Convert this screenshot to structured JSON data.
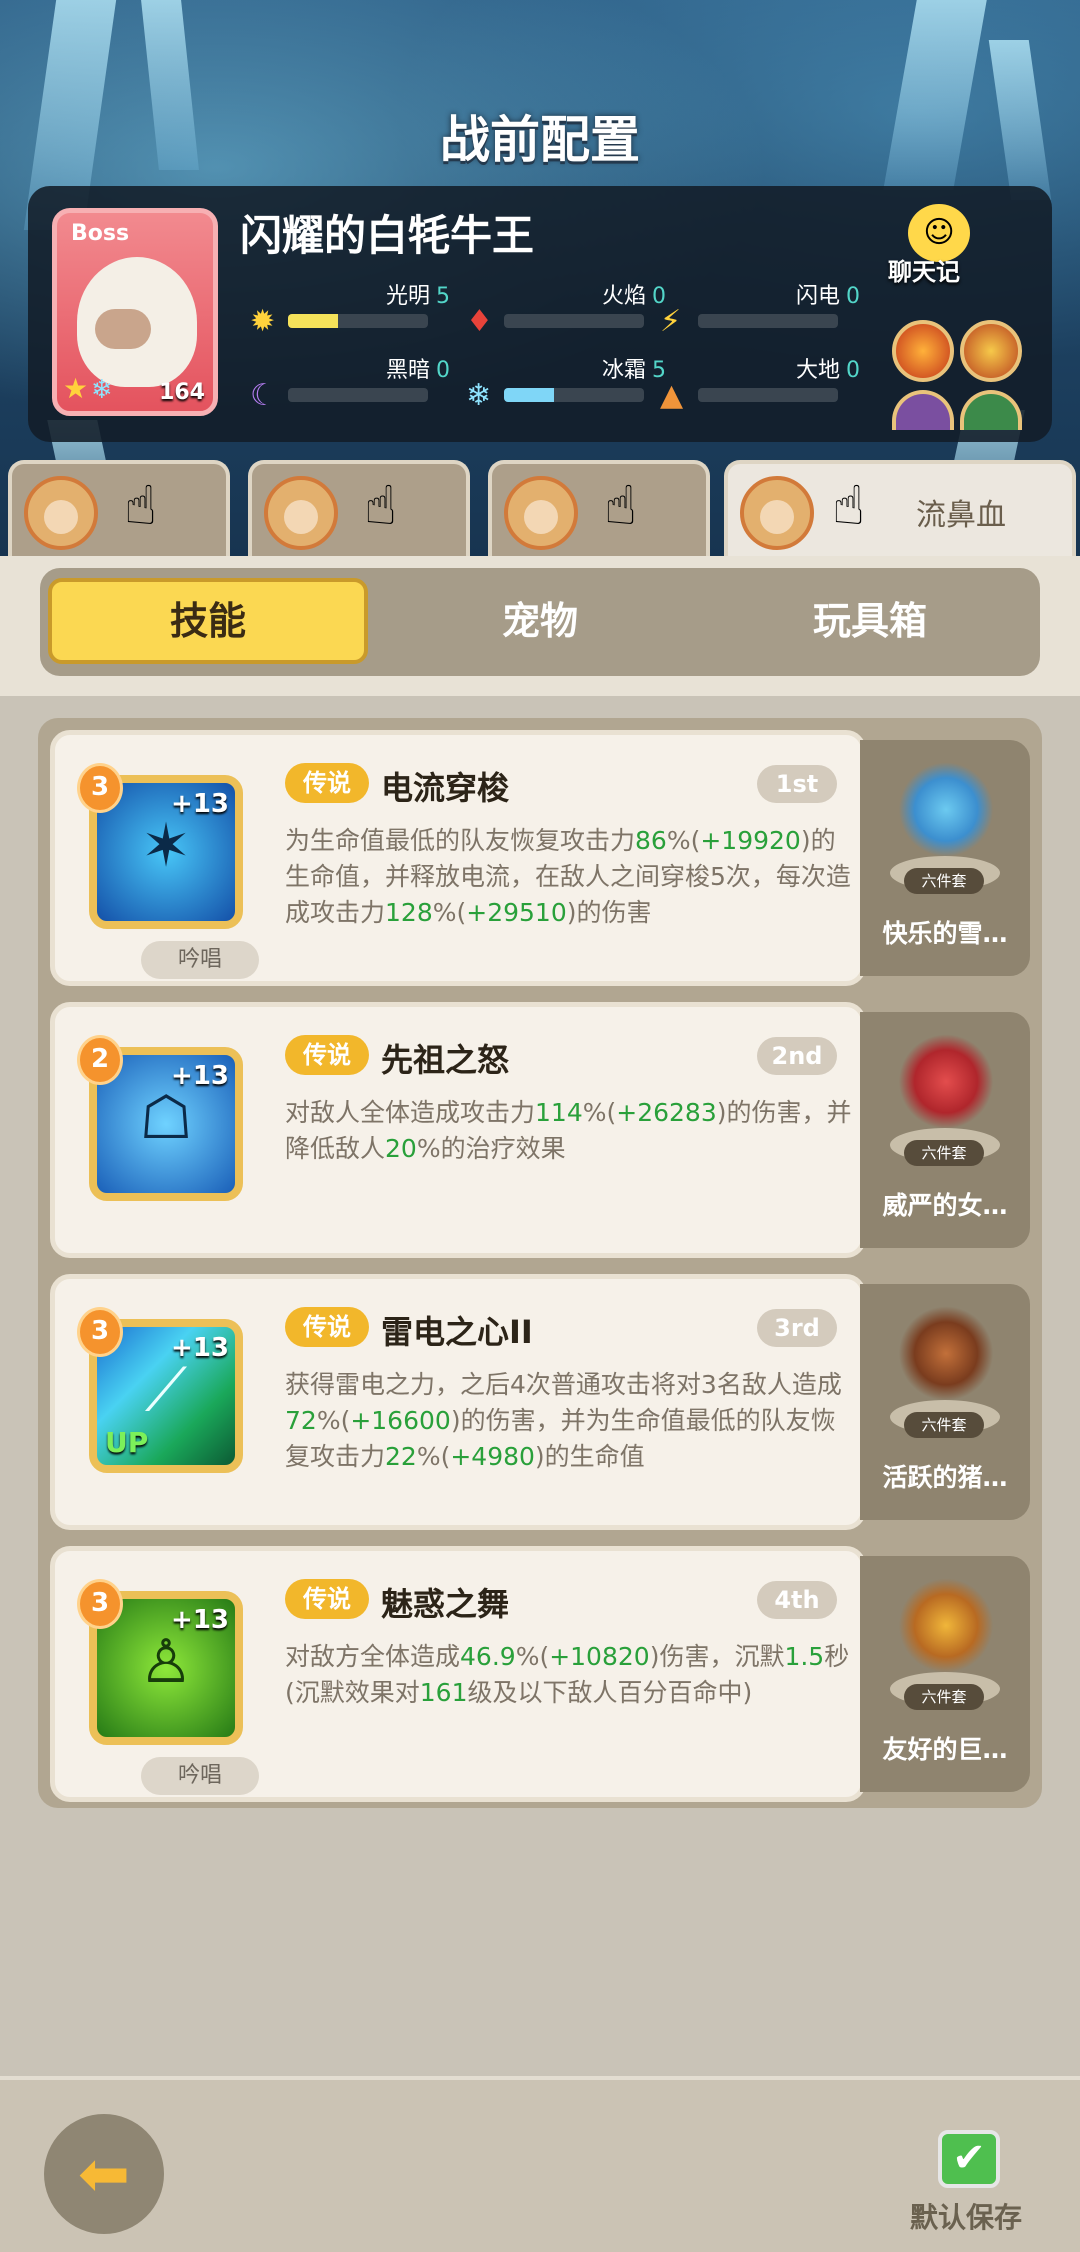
{
  "title": "战前配置",
  "boss": {
    "tag": "Boss",
    "name": "闪耀的白牦牛王",
    "level": "164",
    "chat_label": "聊天记",
    "elements": [
      {
        "name": "光明",
        "value": "5",
        "icon": "sun-icon",
        "fill": 5
      },
      {
        "name": "火焰",
        "value": "0",
        "icon": "flame-icon",
        "fill": 0
      },
      {
        "name": "闪电",
        "value": "0",
        "icon": "lightning-icon",
        "fill": 0
      },
      {
        "name": "黑暗",
        "value": "0",
        "icon": "moon-icon",
        "fill": 0
      },
      {
        "name": "冰霜",
        "value": "5",
        "icon": "snowflake-icon",
        "fill": 5
      },
      {
        "name": "大地",
        "value": "0",
        "icon": "mountain-icon",
        "fill": 0
      }
    ]
  },
  "team_tabs": [
    {
      "name": ""
    },
    {
      "name": ""
    },
    {
      "name": ""
    },
    {
      "name": "流鼻血"
    }
  ],
  "segments": {
    "skills": "技能",
    "pets": "宠物",
    "toybox": "玩具箱",
    "active": "skills"
  },
  "skills": [
    {
      "level": "3",
      "plus": "+13",
      "rarity": "传说",
      "name": "电流穿梭",
      "rank": "1st",
      "chant": "吟唱",
      "desc": [
        {
          "t": "为生命值最低的队友恢复攻击力"
        },
        {
          "t": "86",
          "g": true
        },
        {
          "t": "%("
        },
        {
          "t": "+19920",
          "g": true
        },
        {
          "t": ")的生命值，并释放电流，在敌人之间穿梭5次，每次造成攻击力"
        },
        {
          "t": "128",
          "g": true
        },
        {
          "t": "%("
        },
        {
          "t": "+29510",
          "g": true
        },
        {
          "t": ")的伤害"
        }
      ],
      "pet": {
        "name": "快乐的雪…",
        "tag": "六件套"
      }
    },
    {
      "level": "2",
      "plus": "+13",
      "rarity": "传说",
      "name": "先祖之怒",
      "rank": "2nd",
      "chant": "",
      "desc": [
        {
          "t": "对敌人全体造成攻击力"
        },
        {
          "t": "114",
          "g": true
        },
        {
          "t": "%("
        },
        {
          "t": "+26283",
          "g": true
        },
        {
          "t": ")的伤害，并降低敌人"
        },
        {
          "t": "20",
          "g": true
        },
        {
          "t": "%的治疗效果"
        }
      ],
      "pet": {
        "name": "威严的女…",
        "tag": "六件套"
      }
    },
    {
      "level": "3",
      "plus": "+13",
      "rarity": "传说",
      "name": "雷电之心II",
      "rank": "3rd",
      "chant": "",
      "up": "UP",
      "desc": [
        {
          "t": "获得雷电之力，之后4次普通攻击将对3名敌人造成"
        },
        {
          "t": "72",
          "g": true
        },
        {
          "t": "%("
        },
        {
          "t": "+16600",
          "g": true
        },
        {
          "t": ")的伤害，并为生命值最低的队友恢复攻击力"
        },
        {
          "t": "22",
          "g": true
        },
        {
          "t": "%("
        },
        {
          "t": "+4980",
          "g": true
        },
        {
          "t": ")的生命值"
        }
      ],
      "pet": {
        "name": "活跃的猪…",
        "tag": "六件套"
      }
    },
    {
      "level": "3",
      "plus": "+13",
      "rarity": "传说",
      "name": "魅惑之舞",
      "rank": "4th",
      "chant": "吟唱",
      "desc": [
        {
          "t": "对敌方全体造成"
        },
        {
          "t": "46.9",
          "g": true
        },
        {
          "t": "%("
        },
        {
          "t": "+10820",
          "g": true
        },
        {
          "t": ")伤害，沉默"
        },
        {
          "t": "1.5",
          "g": true
        },
        {
          "t": "秒(沉默效果对"
        },
        {
          "t": "161",
          "g": true
        },
        {
          "t": "级及以下敌人百分百命中)"
        }
      ],
      "pet": {
        "name": "友好的巨…",
        "tag": "六件套"
      }
    }
  ],
  "bottom": {
    "save_label": "默认保存"
  },
  "colors": {
    "accent": "#fbd852",
    "green_value": "#29a03a",
    "rarity": "#f2b72b"
  }
}
